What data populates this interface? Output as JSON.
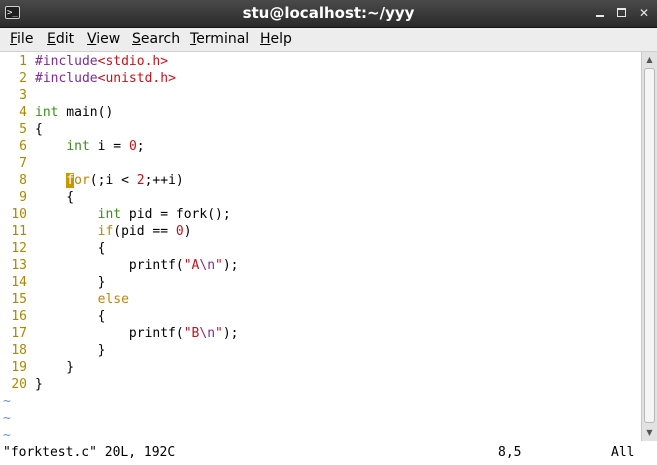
{
  "window": {
    "title": "stu@localhost:~/yyy",
    "terminal_icon_glyph": ">_"
  },
  "menu": {
    "items": [
      {
        "first": "F",
        "rest": "ile"
      },
      {
        "first": "E",
        "rest": "dit"
      },
      {
        "first": "V",
        "rest": "iew"
      },
      {
        "first": "S",
        "rest": "earch"
      },
      {
        "first": "T",
        "rest": "erminal"
      },
      {
        "first": "H",
        "rest": "elp"
      }
    ]
  },
  "editor": {
    "line_numbers": [
      "1",
      "2",
      "3",
      "4",
      "5",
      "6",
      "7",
      "8",
      "9",
      "10",
      "11",
      "12",
      "13",
      "14",
      "15",
      "16",
      "17",
      "18",
      "19",
      "20"
    ],
    "code": {
      "l1": {
        "pp": "#include",
        "str": "<stdio.h>"
      },
      "l2": {
        "pp": "#include",
        "str": "<unistd.h>"
      },
      "l4": {
        "kw": "int",
        "rest": " main()"
      },
      "l5": {
        "text": "{"
      },
      "l6": {
        "indent": "    ",
        "kw": "int",
        "mid": " i = ",
        "num": "0",
        "end": ";"
      },
      "l8": {
        "indent": "    ",
        "cursor": "f",
        "ctl": "or",
        "mid": "(;i < ",
        "num": "2",
        "end": ";++i)"
      },
      "l9": {
        "text": "    {"
      },
      "l10": {
        "indent": "        ",
        "kw": "int",
        "rest": " pid = fork();"
      },
      "l11": {
        "indent": "        ",
        "ctl": "if",
        "mid": "(pid == ",
        "num": "0",
        "end": ")"
      },
      "l12": {
        "text": "        {"
      },
      "l13": {
        "indent": "            ",
        "pre": "printf(",
        "str1": "\"A",
        "esc": "\\n",
        "str2": "\"",
        "end": ");"
      },
      "l14": {
        "text": "        }"
      },
      "l15": {
        "indent": "        ",
        "ctl": "else"
      },
      "l16": {
        "text": "        {"
      },
      "l17": {
        "indent": "            ",
        "pre": "printf(",
        "str1": "\"B",
        "esc": "\\n",
        "str2": "\"",
        "end": ");"
      },
      "l18": {
        "text": "        }"
      },
      "l19": {
        "text": "    }"
      },
      "l20": {
        "text": "}"
      }
    },
    "tilde": "~"
  },
  "status": {
    "file_info": "\"forktest.c\" 20L, 192C",
    "cursor_pos": "8,5",
    "view": "All"
  },
  "colors": {
    "keyword": "#3c8c1e",
    "preprocessor": "#7a2e8e",
    "string": "#c0141c",
    "control": "#b8860b",
    "line_number": "#a68a00",
    "cursor": "#c49a00",
    "tilde": "#6a8ed6"
  }
}
